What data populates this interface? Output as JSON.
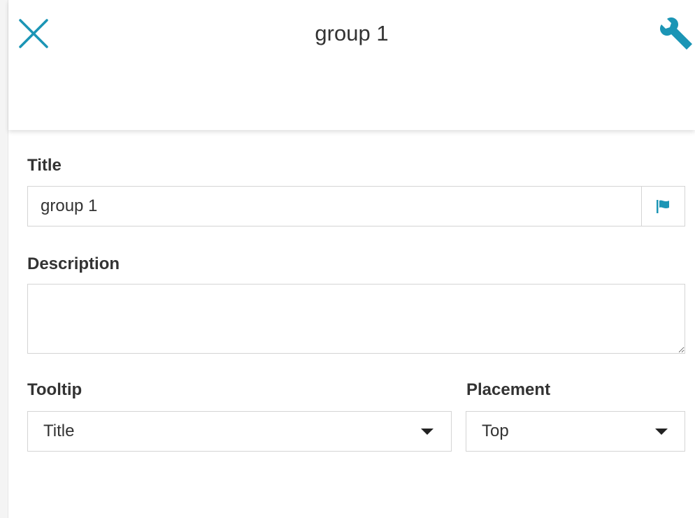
{
  "header": {
    "title": "group 1",
    "close_icon": "close-icon",
    "settings_icon": "wrench-icon"
  },
  "form": {
    "title": {
      "label": "Title",
      "value": "group 1",
      "flag_icon": "flag-icon"
    },
    "description": {
      "label": "Description",
      "value": ""
    },
    "tooltip": {
      "label": "Tooltip",
      "selected": "Title"
    },
    "placement": {
      "label": "Placement",
      "selected": "Top"
    }
  },
  "colors": {
    "accent": "#1b95b5",
    "text": "#333333",
    "border": "#d4d4d4"
  }
}
